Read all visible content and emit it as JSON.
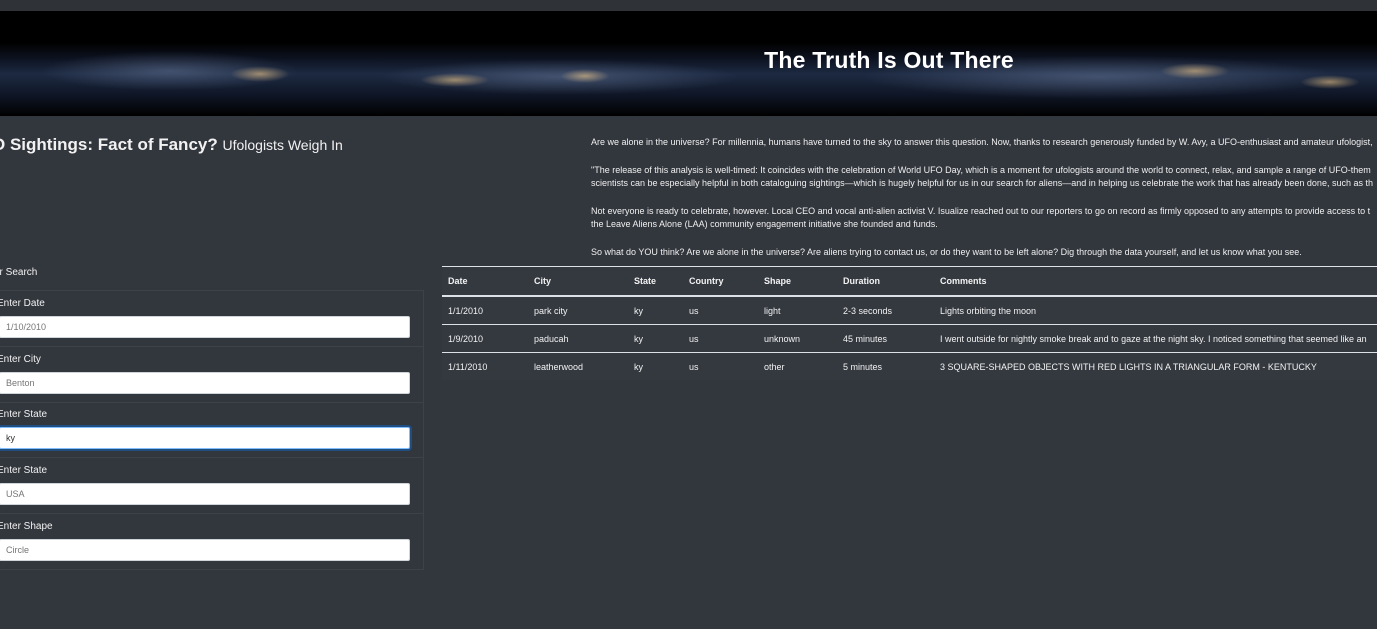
{
  "banner": {
    "title": "The Truth Is Out There"
  },
  "header": {
    "title": "O Sightings: Fact of Fancy?",
    "subtitle": "Ufologists Weigh In"
  },
  "article": {
    "paragraphs": [
      "Are we alone in the universe? For millennia, humans have turned to the sky to answer this question. Now, thanks to research generously funded by W. Avy, a UFO-enthusiast and amateur ufologist,",
      "\"The release of this analysis is well-timed: It coincides with the celebration of World UFO Day, which is a moment for ufologists around the world to connect, relax, and sample a range of UFO-them",
      "scientists can be especially helpful in both cataloguing sightings—which is hugely helpful for us in our search for aliens—and in helping us celebrate the work that has already been done, such as th",
      "Not everyone is ready to celebrate, however. Local CEO and vocal anti-alien activist V. Isualize reached out to our reporters to go on record as firmly opposed to any attempts to provide access to t",
      "the Leave Aliens Alone (LAA) community engagement initiative she founded and funds.",
      "So what do YOU think? Are we alone in the universe? Are aliens trying to contact us, or do they want to be left alone? Dig through the data yourself, and let us know what you see."
    ]
  },
  "filters": {
    "heading": "er Search",
    "items": [
      {
        "label": "Enter Date",
        "value": "",
        "placeholder": "1/10/2010"
      },
      {
        "label": "Enter City",
        "value": "",
        "placeholder": "Benton"
      },
      {
        "label": "Enter State",
        "value": "ky",
        "placeholder": ""
      },
      {
        "label": "Enter State",
        "value": "",
        "placeholder": "USA"
      },
      {
        "label": "Enter Shape",
        "value": "",
        "placeholder": "Circle"
      }
    ]
  },
  "table": {
    "headers": [
      "Date",
      "City",
      "State",
      "Country",
      "Shape",
      "Duration",
      "Comments"
    ],
    "rows": [
      [
        "1/1/2010",
        "park city",
        "ky",
        "us",
        "light",
        "2-3 seconds",
        "Lights orbiting the moon"
      ],
      [
        "1/9/2010",
        "paducah",
        "ky",
        "us",
        "unknown",
        "45 minutes",
        "I went outside for nightly smoke break and to gaze at the night sky. I noticed something that seemed like an"
      ],
      [
        "1/11/2010",
        "leatherwood",
        "ky",
        "us",
        "other",
        "5 minutes",
        "3 SQUARE-SHAPED OBJECTS WITH RED LIGHTS IN A TRIANGULAR FORM - KENTUCKY"
      ]
    ]
  }
}
